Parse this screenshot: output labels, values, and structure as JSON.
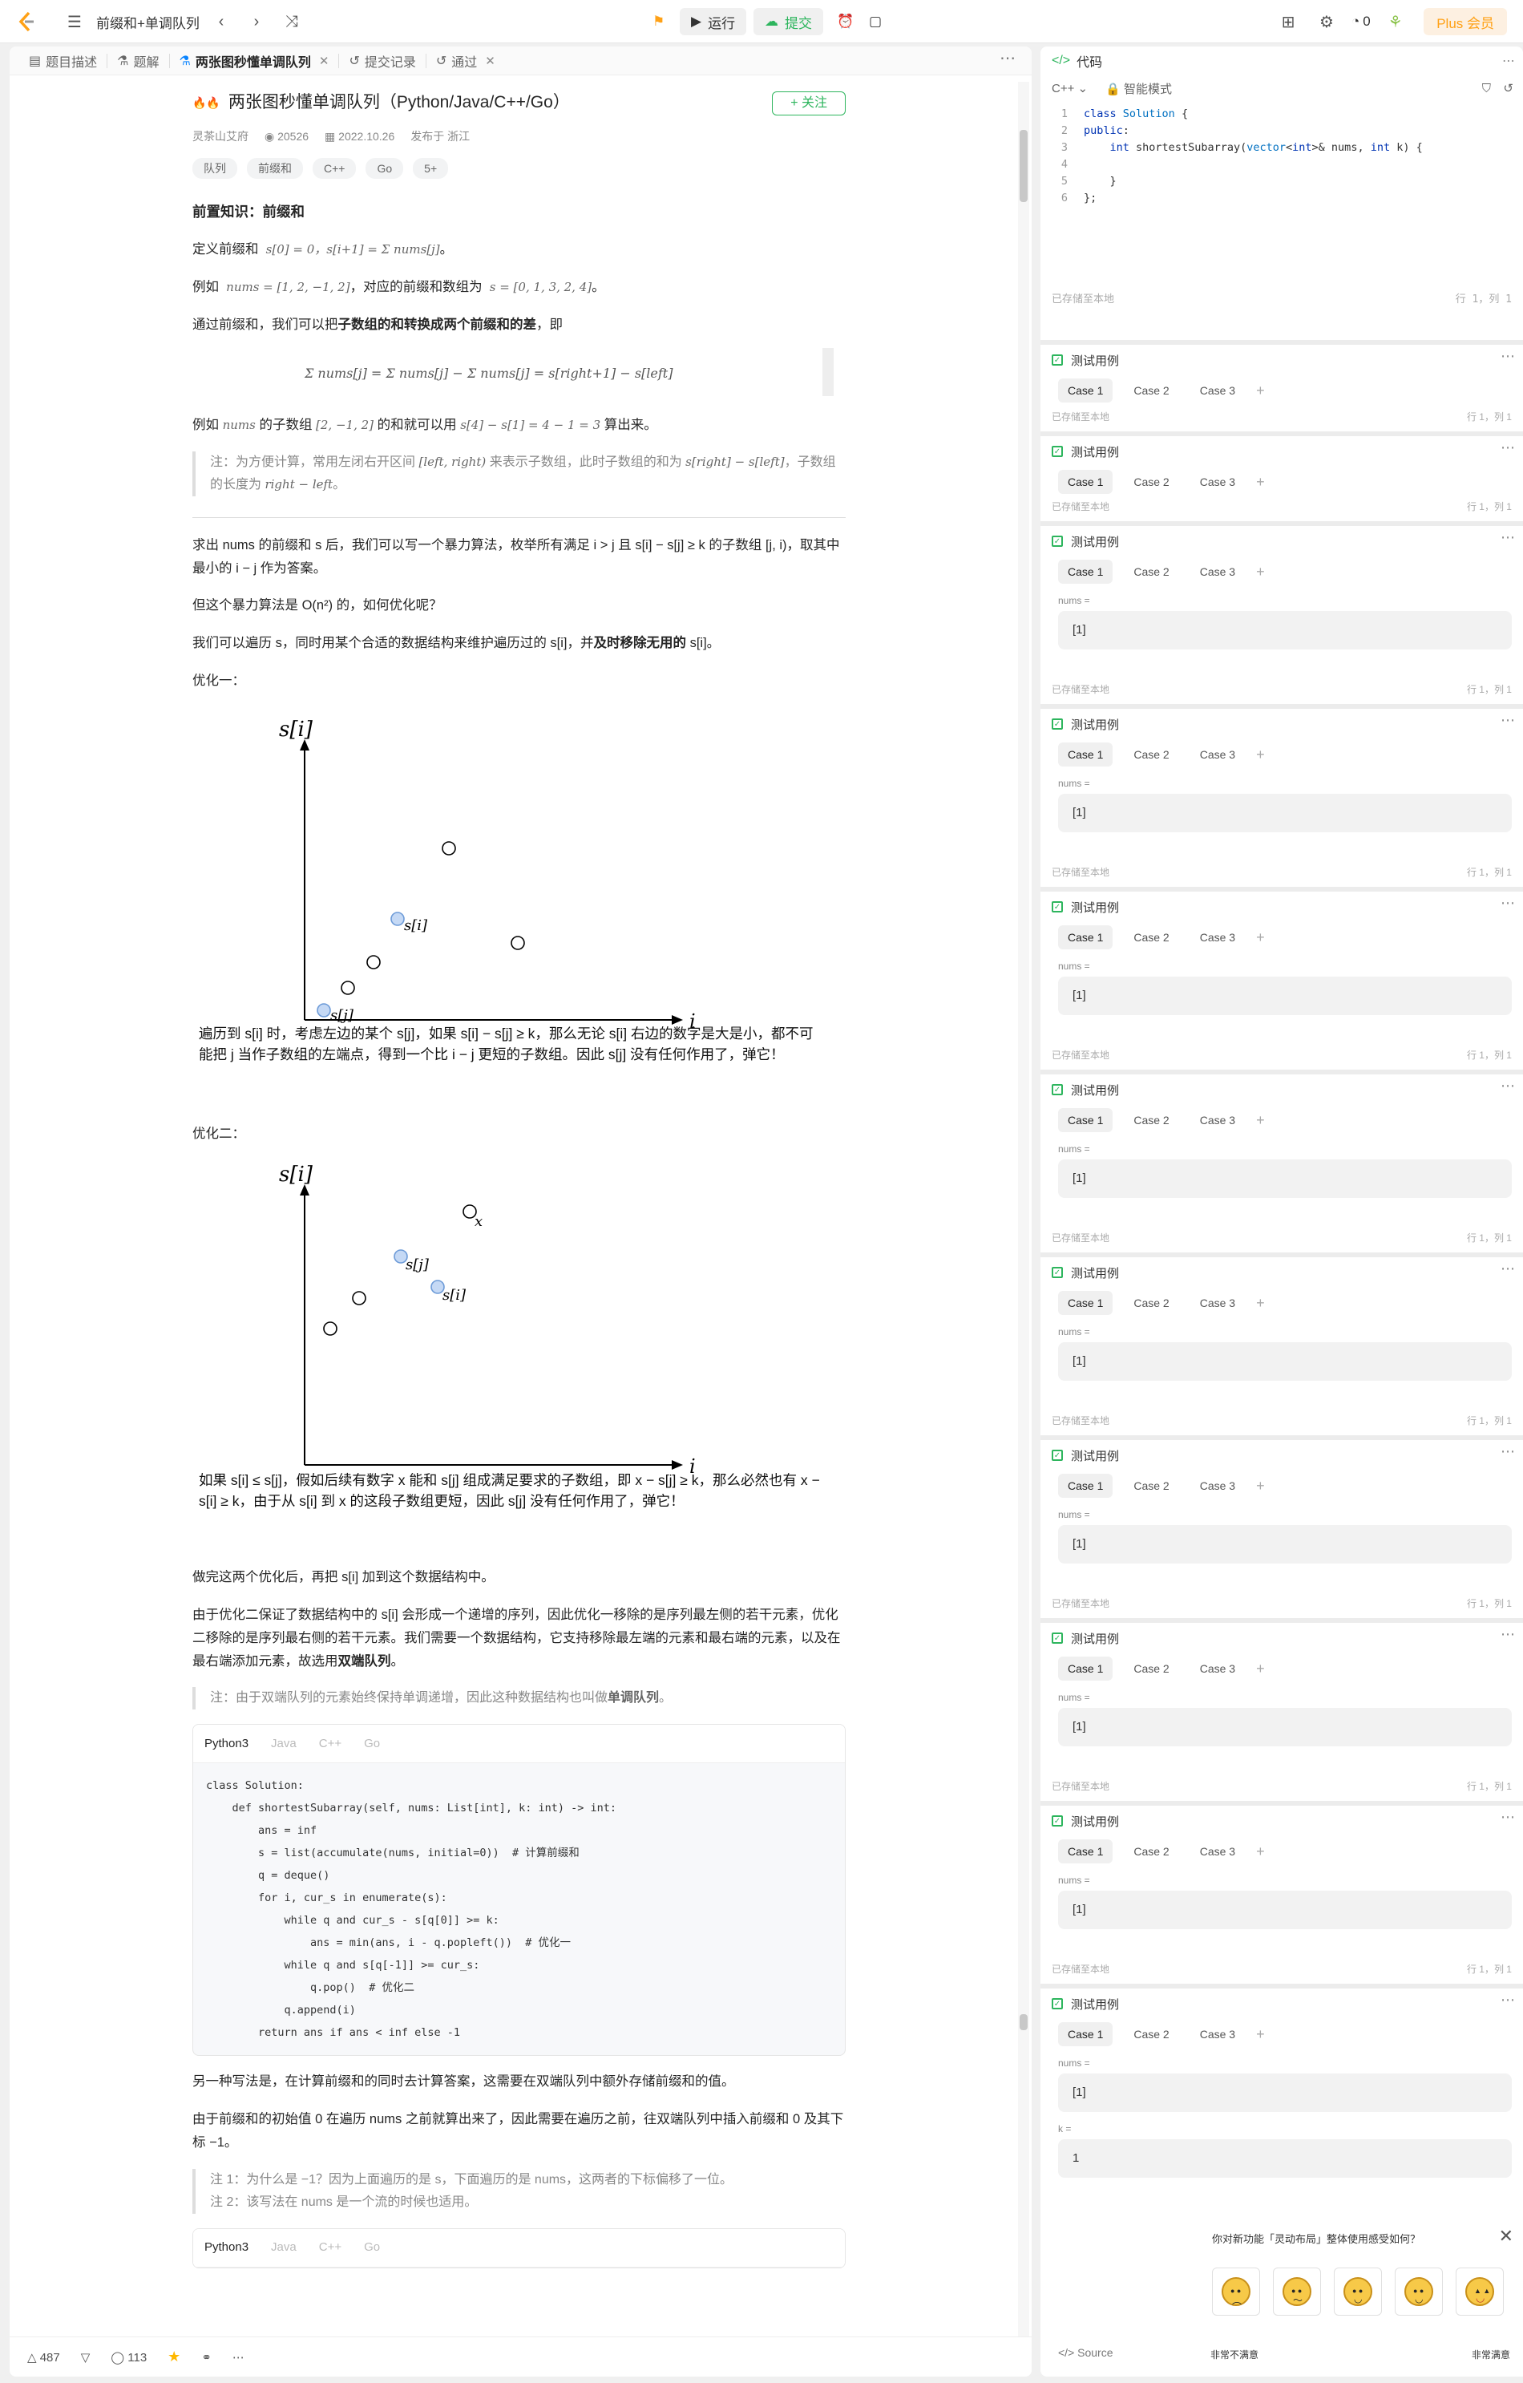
{
  "topbar": {
    "problem_title": "前缀和+单调队列",
    "run_label": "运行",
    "submit_label": "提交",
    "points": "0",
    "plus_label": "Plus 会员"
  },
  "tabs": [
    "题目描述",
    "题解",
    "两张图秒懂单调队列",
    "提交记录",
    "通过"
  ],
  "article": {
    "title": "两张图秒懂单调队列（Python/Java/C++/Go）",
    "follow": "+ 关注",
    "author": "灵茶山艾府",
    "views": "20526",
    "date": "2022.10.26",
    "location": "发布于 浙江",
    "tags": [
      "队列",
      "前缀和",
      "C++",
      "Go",
      "5+"
    ],
    "h_prefix": "前置知识：前缀和",
    "p1": "定义前缀和",
    "p1_math": "s[0] = 0，s[i+1] = Σ nums[j]",
    "p2a": "例如",
    "p2_math1": "nums = [1, 2, −1, 2]",
    "p2b": "，对应的前缀和数组为",
    "p2_math2": "s = [0, 1, 3, 2, 4]",
    "p3a": "通过前缀和，我们可以把",
    "p3b": "子数组的和转换成两个前缀和的差",
    "p3c": "，即",
    "formula": "Σ nums[j] = Σ nums[j] − Σ nums[j] = s[right+1] − s[left]",
    "p4a": "例如",
    "p4_math1": "nums",
    "p4b": "的子数组",
    "p4_math2": "[2, −1, 2]",
    "p4c": "的和就可以用",
    "p4_math3": "s[4] − s[1] = 4 − 1 = 3",
    "p4d": "算出来。",
    "quote1a": "注：为方便计算，常用左闭右开区间",
    "quote1_math1": "[left, right)",
    "quote1b": "来表示子数组，此时子数组的和为",
    "quote1_math2": "s[right] − s[left]",
    "quote1c": "，子数组的长度为",
    "quote1_math3": "right − left",
    "quote1d": "。",
    "p5": "求出 nums 的前缀和 s 后，我们可以写一个暴力算法，枚举所有满足 i > j 且 s[i] − s[j] ≥ k 的子数组 [j, i)，取其中最小的 i − j 作为答案。",
    "p6": "但这个暴力算法是 O(n²) 的，如何优化呢？",
    "p7a": "我们可以遍历 s，同时用某个合适的数据结构来维护遍历过的 s[i]，并",
    "p7b": "及时移除无用的",
    "p7c": " s[i]。",
    "opt1": "优化一：",
    "fig1": {
      "ylabel": "s[i]",
      "xlabel": "i",
      "label_si": "s[i]",
      "label_sj": "s[j]",
      "caption": "遍历到 s[i] 时，考虑左边的某个 s[j]，如果 s[i] − s[j] ≥ k，那么无论 s[i] 右边的数字是大是小，都不可能把 j 当作子数组的左端点，得到一个比 i − j 更短的子数组。因此 s[j] 没有任何作用了，弹它！"
    },
    "opt2": "优化二：",
    "fig2": {
      "ylabel": "s[i]",
      "xlabel": "i",
      "label_x": "x",
      "label_sj": "s[j]",
      "label_si": "s[i]",
      "caption": "如果 s[i] ≤ s[j]，假如后续有数字 x 能和 s[j] 组成满足要求的子数组，即 x − s[j] ≥ k，那么必然也有 x − s[i] ≥ k，由于从 s[i] 到 x 的这段子数组更短，因此 s[j] 没有任何作用了，弹它！"
    },
    "p8": "做完这两个优化后，再把 s[i] 加到这个数据结构中。",
    "p9a": "由于优化二保证了数据结构中的 s[i] 会形成一个递增的序列，因此优化一移除的是序列最左侧的若干元素，优化二移除的是序列最右侧的若干元素。我们需要一个数据结构，它支持移除最左端的元素和最右端的元素，以及在最右端添加元素，故选用",
    "p9b": "双端队列",
    "p9c": "。",
    "quote2a": "注：由于双端队列的元素始终保持单调递增，因此这种数据结构也叫做",
    "quote2b": "单调队列",
    "quote2c": "。",
    "code_tabs": [
      "Python3",
      "Java",
      "C++",
      "Go"
    ],
    "code_lines": [
      [
        "class Solution:"
      ],
      [
        "    def shortestSubarray(self, nums: List[int], k: int) -> int:"
      ],
      [
        "        ans = inf"
      ],
      [
        "        s = list(accumulate(nums, initial=0))  # 计算前缀和"
      ],
      [
        "        q = deque()"
      ],
      [
        "        for i, cur_s in enumerate(s):"
      ],
      [
        "            while q and cur_s - s[q[0]] >= k:"
      ],
      [
        "                ans = min(ans, i - q.popleft())  # 优化一"
      ],
      [
        "            while q and s[q[-1]] >= cur_s:"
      ],
      [
        "                q.pop()  # 优化二"
      ],
      [
        "            q.append(i)"
      ],
      [
        "        return ans if ans < inf else -1"
      ]
    ],
    "p10": "另一种写法是，在计算前缀和的同时去计算答案，这需要在双端队列中额外存储前缀和的值。",
    "p11": "由于前缀和的初始值 0 在遍历 nums 之前就算出来了，因此需要在遍历之前，往双端队列中插入前缀和 0 及其下标 −1。",
    "quote3a": "注 1：为什么是 −1？因为上面遍历的是 s，下面遍历的是 nums，这两者的下标偏移了一位。",
    "quote3b": "注 2：该写法在 nums 是一个流的时候也适用。",
    "code_tabs2": [
      "Python3",
      "Java",
      "C++",
      "Go"
    ]
  },
  "bottombar": {
    "likes": "487",
    "comments": "113"
  },
  "code_panel": {
    "title": "代码",
    "lang": "C++",
    "mode": "智能模式",
    "line_numbers": [
      "1",
      "2",
      "3",
      "4",
      "5",
      "6"
    ],
    "lines": [
      "class Solution {",
      "public:",
      "    int shortestSubarray(vector<int>& nums, int k) {",
      "",
      "    }",
      "};"
    ],
    "saved": "已存储至本地",
    "pos": "行 1，列 1"
  },
  "testcases": {
    "title": "测试用例",
    "tabs": [
      "Case 1",
      "Case 2",
      "Case 3"
    ],
    "nums_label": "nums =",
    "nums_value": "[1]",
    "k_label": "k =",
    "k_value": "1",
    "saved": "已存储至本地",
    "pos": "行 1，列 1"
  },
  "survey": {
    "question": "你对新功能「灵动布局」整体使用感受如何？",
    "low": "非常不满意",
    "high": "非常满意",
    "source": "Source"
  }
}
